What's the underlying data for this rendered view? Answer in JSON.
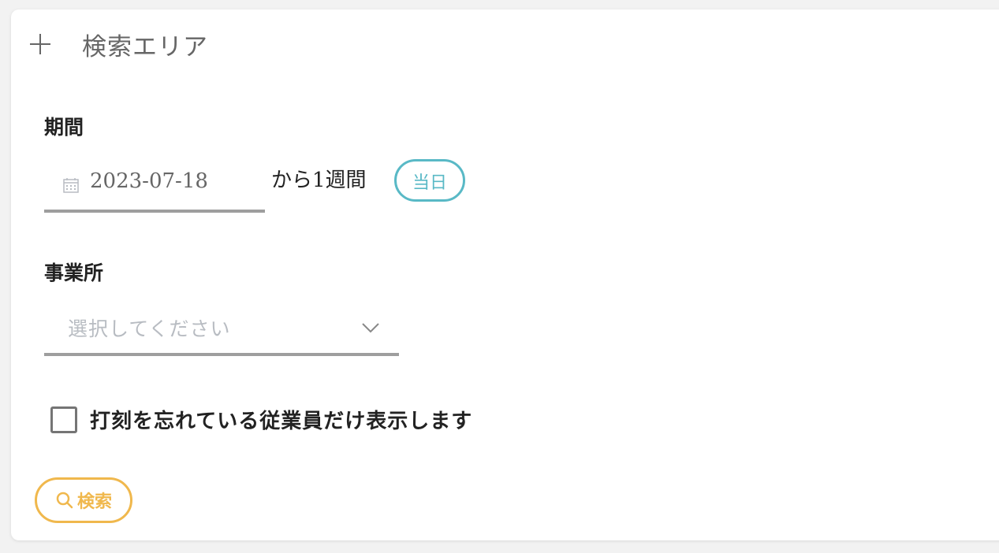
{
  "search_area": {
    "title": "検索エリア",
    "period": {
      "label": "期間",
      "date_value": "2023-07-18",
      "suffix": "から1週間",
      "today_button": "当日"
    },
    "office": {
      "label": "事業所",
      "placeholder": "選択してください"
    },
    "checkbox": {
      "label": "打刻を忘れている従業員だけ表示します",
      "checked": false
    },
    "search_button": "検索"
  },
  "colors": {
    "today_accent": "#59b9c6",
    "search_accent": "#f0b84d",
    "underline": "#9e9e9e"
  },
  "icons": {
    "expand": "plus-icon",
    "date": "calendar-icon",
    "select": "chevron-down-icon",
    "search": "search-icon"
  }
}
